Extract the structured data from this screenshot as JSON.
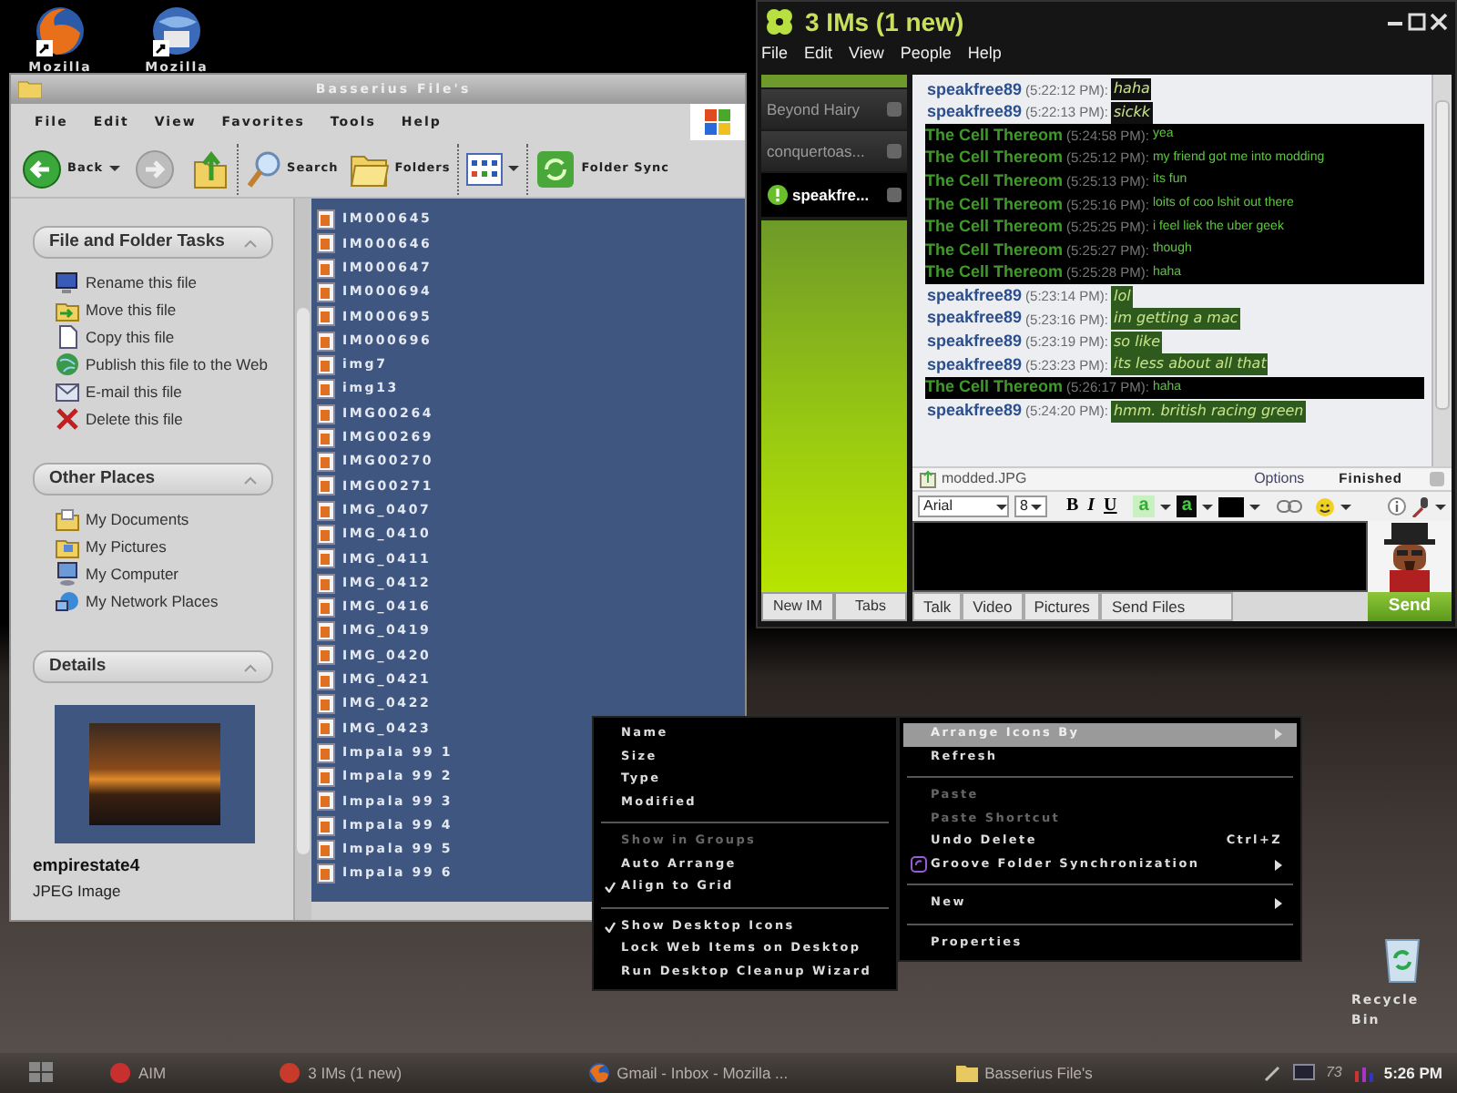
{
  "desktop_icons": [
    {
      "label": "Mozilla",
      "kind": "browser"
    },
    {
      "label": "Mozilla",
      "kind": "mail"
    }
  ],
  "explorer": {
    "title": "Basserius File's",
    "menu": [
      "File",
      "Edit",
      "View",
      "Favorites",
      "Tools",
      "Help"
    ],
    "toolbar": [
      {
        "kind": "back",
        "label": "Back"
      },
      {
        "kind": "forward"
      },
      {
        "kind": "up"
      },
      {
        "kind": "search",
        "label": "Search"
      },
      {
        "kind": "folders",
        "label": "Folders"
      },
      {
        "kind": "views"
      },
      {
        "kind": "sync",
        "label": "Folder Sync"
      }
    ],
    "tasks": {
      "title": "File and Folder Tasks",
      "items": [
        "Rename this file",
        "Move this file",
        "Copy this file",
        "Publish this file to the Web",
        "E-mail this file",
        "Delete this file"
      ]
    },
    "places": {
      "title": "Other Places",
      "items": [
        "My Documents",
        "My Pictures",
        "My Computer",
        "My Network Places"
      ]
    },
    "details": {
      "title": "Details",
      "name": "empirestate4",
      "type": "JPEG Image"
    },
    "files": [
      {
        "name": "IM000645",
        "selected": true
      },
      {
        "name": "IM000646",
        "selected": true
      },
      {
        "name": "IM000647",
        "selected": true
      },
      {
        "name": "IM000694",
        "selected": true
      },
      {
        "name": "IM000695",
        "selected": true
      },
      {
        "name": "IM000696",
        "selected": true
      },
      {
        "name": "img7",
        "selected": true
      },
      {
        "name": "img13",
        "selected": true
      },
      {
        "name": "IMG00264",
        "selected": true
      },
      {
        "name": "IMG00269",
        "selected": true
      },
      {
        "name": "IMG00270",
        "selected": true
      },
      {
        "name": "IMG00271",
        "selected": true
      },
      {
        "name": "IMG_0407",
        "selected": true
      },
      {
        "name": "IMG_0410",
        "selected": true
      },
      {
        "name": "IMG_0411",
        "selected": true
      },
      {
        "name": "IMG_0412",
        "selected": true
      },
      {
        "name": "IMG_0416",
        "selected": true
      },
      {
        "name": "IMG_0419",
        "selected": true
      },
      {
        "name": "IMG_0420",
        "selected": true
      },
      {
        "name": "IMG_0421",
        "selected": true
      },
      {
        "name": "IMG_0422",
        "selected": true
      },
      {
        "name": "IMG_0423",
        "selected": true
      },
      {
        "name": "Impala 99 1",
        "selected": true
      },
      {
        "name": "Impala 99 2",
        "selected": true
      },
      {
        "name": "Impala 99 3",
        "selected": true
      },
      {
        "name": "Impala 99 4",
        "selected": true
      },
      {
        "name": "Impala 99 5",
        "selected": true
      },
      {
        "name": "Impala 99 6",
        "selected": true
      }
    ]
  },
  "im": {
    "title": "3 IMs (1 new)",
    "menu": [
      "File",
      "Edit",
      "View",
      "People",
      "Help"
    ],
    "tabs": [
      {
        "label": "Beyond Hairy",
        "selected": false,
        "alert": false
      },
      {
        "label": "conquertoas...",
        "selected": false,
        "alert": false
      },
      {
        "label": "speakfre...",
        "selected": true,
        "alert": true
      }
    ],
    "side_buttons": [
      "New IM",
      "Tabs"
    ],
    "messages": [
      {
        "kind": "self",
        "sender": "speakfree89",
        "time": "(5:22:12 PM):",
        "text": "haha",
        "color": "#101010"
      },
      {
        "kind": "self",
        "sender": "speakfree89",
        "time": "(5:22:13 PM):",
        "text": "sickk",
        "color": "#101010"
      },
      {
        "kind": "buddy",
        "sender": "The Cell Thereom",
        "time": "(5:24:58 PM):",
        "text": "yea"
      },
      {
        "kind": "buddy",
        "sender": "The Cell Thereom",
        "time": "(5:25:12 PM):",
        "text": "my friend got me into modding"
      },
      {
        "kind": "buddy",
        "sender": "The Cell Thereom",
        "time": "(5:25:13 PM):",
        "text": "its fun"
      },
      {
        "kind": "buddy",
        "sender": "The Cell Thereom",
        "time": "(5:25:16 PM):",
        "text": "loits of coo lshit out there"
      },
      {
        "kind": "buddy",
        "sender": "The Cell Thereom",
        "time": "(5:25:25 PM):",
        "text": "i feel liek the uber geek"
      },
      {
        "kind": "buddy",
        "sender": "The Cell Thereom",
        "time": "(5:25:27 PM):",
        "text": "though"
      },
      {
        "kind": "buddy",
        "sender": "The Cell Thereom",
        "time": "(5:25:28 PM):",
        "text": "haha"
      },
      {
        "kind": "self",
        "sender": "speakfree89",
        "time": "(5:23:14 PM):",
        "text": "lol",
        "color": "#2f5a1e"
      },
      {
        "kind": "self",
        "sender": "speakfree89",
        "time": "(5:23:16 PM):",
        "text": "im getting a mac",
        "color": "#2f5a1e"
      },
      {
        "kind": "self",
        "sender": "speakfree89",
        "time": "(5:23:19 PM):",
        "text": "so like",
        "color": "#2f5a1e"
      },
      {
        "kind": "self",
        "sender": "speakfree89",
        "time": "(5:23:23 PM):",
        "text": "its less about all that",
        "color": "#2f5a1e"
      },
      {
        "kind": "buddy",
        "sender": "The Cell Thereom",
        "time": "(5:26:17 PM):",
        "text": "haha"
      },
      {
        "kind": "self",
        "sender": "speakfree89",
        "time": "(5:24:20 PM):",
        "text": "hmm. british racing green",
        "color": "#2f5a1e"
      }
    ],
    "transfer": {
      "file": "modded.JPG",
      "options": "Options",
      "status": "Finished"
    },
    "format_bar": {
      "font": "Arial",
      "size": "8",
      "bold": "B",
      "italic": "I",
      "underline": "U",
      "text_color": "a",
      "back_color": "a"
    },
    "bottom_tabs": [
      "Talk",
      "Video",
      "Pictures",
      "Send Files"
    ],
    "send": "Send"
  },
  "context_menu": {
    "submenu": [
      [
        {
          "label": "Name",
          "checked": false,
          "disabled": false
        },
        {
          "label": "Size",
          "checked": false,
          "disabled": false
        },
        {
          "label": "Type",
          "checked": false,
          "disabled": false
        },
        {
          "label": "Modified",
          "checked": false,
          "disabled": false
        }
      ],
      [
        {
          "label": "Show in Groups",
          "checked": false,
          "disabled": true
        },
        {
          "label": "Auto Arrange",
          "checked": false,
          "disabled": false
        },
        {
          "label": "Align to Grid",
          "checked": true,
          "disabled": false
        }
      ],
      [
        {
          "label": "Show Desktop Icons",
          "checked": true,
          "disabled": false
        },
        {
          "label": "Lock Web Items on Desktop",
          "checked": false,
          "disabled": false
        },
        {
          "label": "Run Desktop Cleanup Wizard",
          "checked": false,
          "disabled": false
        }
      ]
    ],
    "main": [
      [
        {
          "label": "Arrange Icons By",
          "selected": true,
          "disabled": false,
          "submenu": true
        },
        {
          "label": "Refresh",
          "selected": false,
          "disabled": false,
          "submenu": false
        }
      ],
      [
        {
          "label": "Paste",
          "selected": false,
          "disabled": true,
          "submenu": false
        },
        {
          "label": "Paste Shortcut",
          "selected": false,
          "disabled": true,
          "submenu": false
        },
        {
          "label": "Undo Delete",
          "selected": false,
          "disabled": false,
          "submenu": false,
          "shortcut": "Ctrl+Z"
        },
        {
          "label": "Groove Folder Synchronization",
          "selected": false,
          "disabled": false,
          "submenu": true,
          "icon": true
        }
      ],
      [
        {
          "label": "New",
          "selected": false,
          "disabled": false,
          "submenu": true
        }
      ],
      [
        {
          "label": "Properties",
          "selected": false,
          "disabled": false,
          "submenu": false
        }
      ]
    ]
  },
  "recycle_bin": {
    "label": "Recycle Bin"
  },
  "taskbar": {
    "buttons": [
      {
        "label": "AIM",
        "kind": "aim"
      },
      {
        "label": "3 IMs (1 new)",
        "kind": "im"
      },
      {
        "label": "Gmail - Inbox - Mozilla ...",
        "kind": "browser"
      },
      {
        "label": "Basserius File's",
        "kind": "folder"
      }
    ],
    "tray_text": "73",
    "clock": "5:26 PM"
  }
}
